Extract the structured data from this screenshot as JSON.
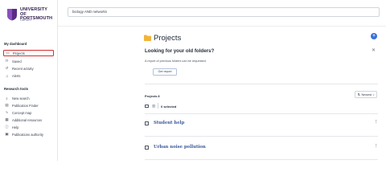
{
  "logo": {
    "line1": "UNIVERSITY OF",
    "line2": "PORTSMOUTH",
    "line3": "LIBRARY"
  },
  "sidebar": {
    "dashboard_title": "My dashboard",
    "dashboard_items": [
      {
        "label": "Projects",
        "icon": "folder-icon",
        "active": true
      },
      {
        "label": "Saved",
        "icon": "bookmark-icon"
      },
      {
        "label": "Recent activity",
        "icon": "history-icon"
      },
      {
        "label": "Alerts",
        "icon": "bell-icon"
      }
    ],
    "research_title": "Research tools",
    "research_items": [
      {
        "label": "New search",
        "icon": "search-icon"
      },
      {
        "label": "Publication Finder",
        "icon": "book-icon"
      },
      {
        "label": "Concept map",
        "icon": "concept-map-icon"
      },
      {
        "label": "Additional resources",
        "icon": "resources-icon"
      },
      {
        "label": "Help",
        "icon": "help-icon"
      },
      {
        "label": "Publications authority",
        "icon": "authority-icon"
      }
    ]
  },
  "search": {
    "value": "biology AND networks"
  },
  "main": {
    "title": "Projects",
    "banner": {
      "title": "Looking for your old folders?",
      "text": "A report of previous folders can be requested.",
      "button": "Get report"
    },
    "projects_label": "Projects 8",
    "sort_label": "Newest",
    "selected_label": "0 selected",
    "projects": [
      {
        "name": "Student help"
      },
      {
        "name": "Urban noise pollution"
      }
    ]
  },
  "colors": {
    "accent": "#3b6fd9",
    "project_link": "#3b5a9a",
    "active_border": "#d32f2f",
    "folder": "#f2b43a"
  }
}
